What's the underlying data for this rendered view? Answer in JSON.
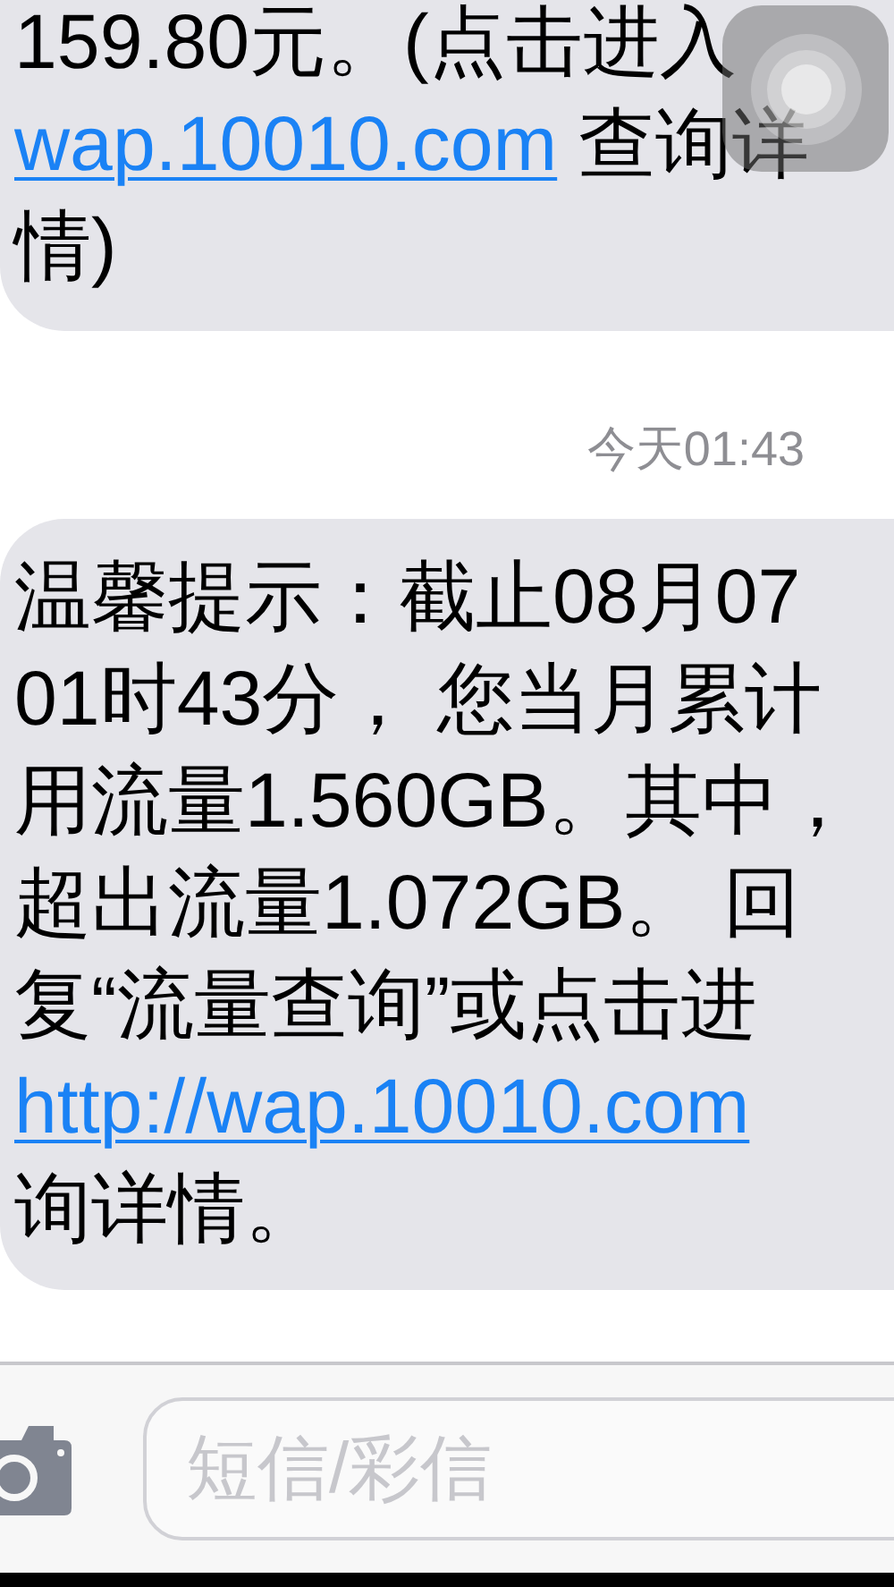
{
  "messages": [
    {
      "lines": [
        [
          {
            "kind": "text",
            "text": "159.80元。(点击进入"
          }
        ],
        [
          {
            "kind": "link",
            "text": "wap.10010.com"
          },
          {
            "kind": "text",
            "text": " 查询详"
          }
        ],
        [
          {
            "kind": "text",
            "text": "情)"
          }
        ]
      ]
    },
    {
      "timestamp": "今天01:43",
      "lines": [
        [
          {
            "kind": "text",
            "text": "温馨提示：截止08月07"
          }
        ],
        [
          {
            "kind": "text",
            "text": "01时43分， 您当月累计"
          }
        ],
        [
          {
            "kind": "text",
            "text": "用流量1.560GB。其中，"
          }
        ],
        [
          {
            "kind": "text",
            "text": "超出流量1.072GB。 回"
          }
        ],
        [
          {
            "kind": "text",
            "text": "复“流量查询”或点击进"
          }
        ],
        [
          {
            "kind": "link",
            "text": "http://wap.10010.com"
          }
        ],
        [
          {
            "kind": "text",
            "text": "询详情。"
          }
        ]
      ]
    }
  ],
  "composer": {
    "placeholder": "短信/彩信"
  }
}
